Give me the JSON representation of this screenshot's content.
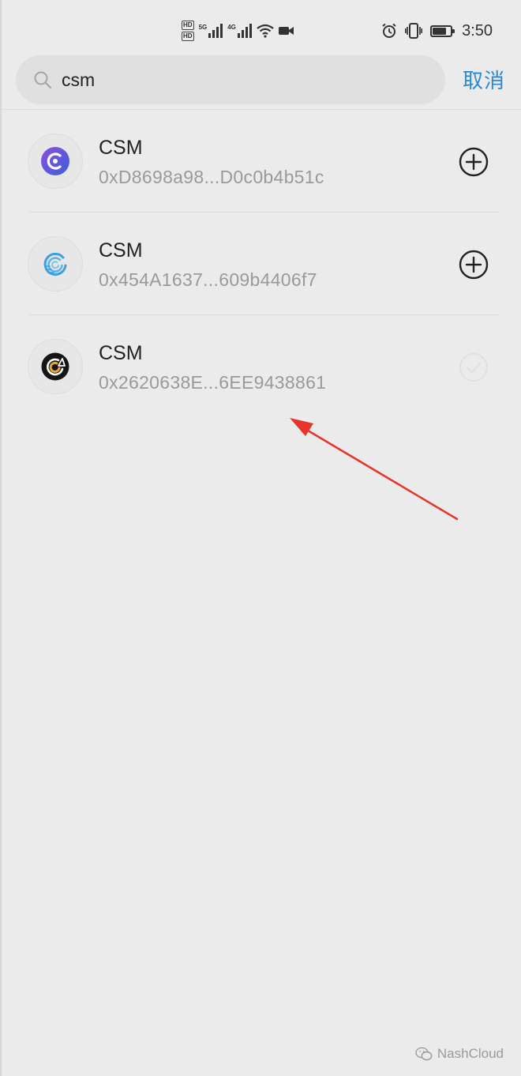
{
  "status_bar": {
    "hd_badges": [
      "HD",
      "HD"
    ],
    "signal_1_label": "5G",
    "signal_2_label": "4G",
    "time": "3:50",
    "battery_level": 0.75,
    "icons": [
      "alarm-icon",
      "vibrate-icon",
      "battery-icon",
      "wifi-icon",
      "video-icon"
    ]
  },
  "search": {
    "value": "csm",
    "cancel_label": "取消",
    "accent_color": "#2a8ad8"
  },
  "tokens": [
    {
      "name": "CSM",
      "address": "0xD8698a98...D0c0b4b51c",
      "logo": "purple-c-logo",
      "action": "add-icon"
    },
    {
      "name": "CSM",
      "address": "0x454A1637...609b4406f7",
      "logo": "blue-swirl-logo",
      "action": "add-icon"
    },
    {
      "name": "CSM",
      "address": "0x2620638E...6EE9438861",
      "logo": "black-gold-logo",
      "action": "added-check-icon"
    }
  ],
  "annotation": {
    "color": "#e8352b",
    "icon": "red-arrow"
  },
  "watermark": {
    "text": "NashCloud",
    "icon": "wechat-icon"
  }
}
